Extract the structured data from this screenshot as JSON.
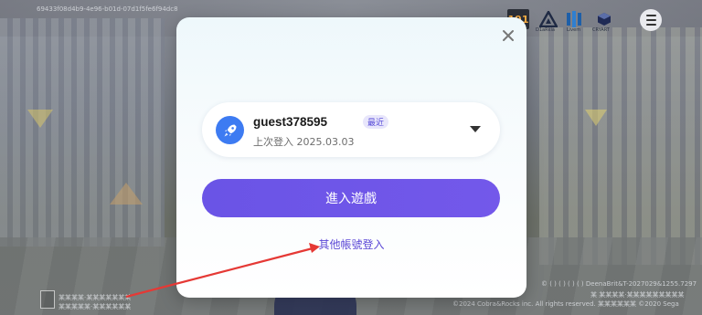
{
  "background": {
    "top_code": "69433f08d4b9-4e96-b01d-07d1f5fe6f94dc8",
    "left_info_1": "某某某某·某某某某某某某",
    "left_info_2": "某某某某某·某某某某某某",
    "copyright_1": "© ( ) ( ) ( ) ( ) DeenaBrit&T-2027029&1255.7297",
    "copyright_2": "某 某某某某·某某某某某某某某某",
    "copyright_3": "©2024 Cobra&Rocks inc. All rights reserved. 某某某某某某 ©2020 Sega"
  },
  "brand_logos": [
    {
      "icon": "sega-logo-icon",
      "label": "191"
    },
    {
      "icon": "triangle-logo-icon",
      "label": "D1aRkia"
    },
    {
      "icon": "bars-logo-icon",
      "label": "Livem"
    },
    {
      "icon": "cube-logo-icon",
      "label": "CRYART"
    }
  ],
  "menu": {
    "icon": "hamburger-menu-icon"
  },
  "modal": {
    "close_icon": "close-icon",
    "account": {
      "avatar_icon": "rocket-icon",
      "username": "guest378595",
      "badge": "最近",
      "last_login": "上次登入 2025.03.03",
      "dropdown_icon": "caret-down-icon"
    },
    "enter_button": "進入遊戲",
    "other_account_link": "其他帳號登入"
  },
  "annotation": {
    "type": "red-arrow",
    "color": "#e53935"
  },
  "colors": {
    "primary": "#6a54e6",
    "link": "#5c49d6",
    "avatar": "#3d7bf2",
    "badge_bg": "#e8e6fb"
  }
}
